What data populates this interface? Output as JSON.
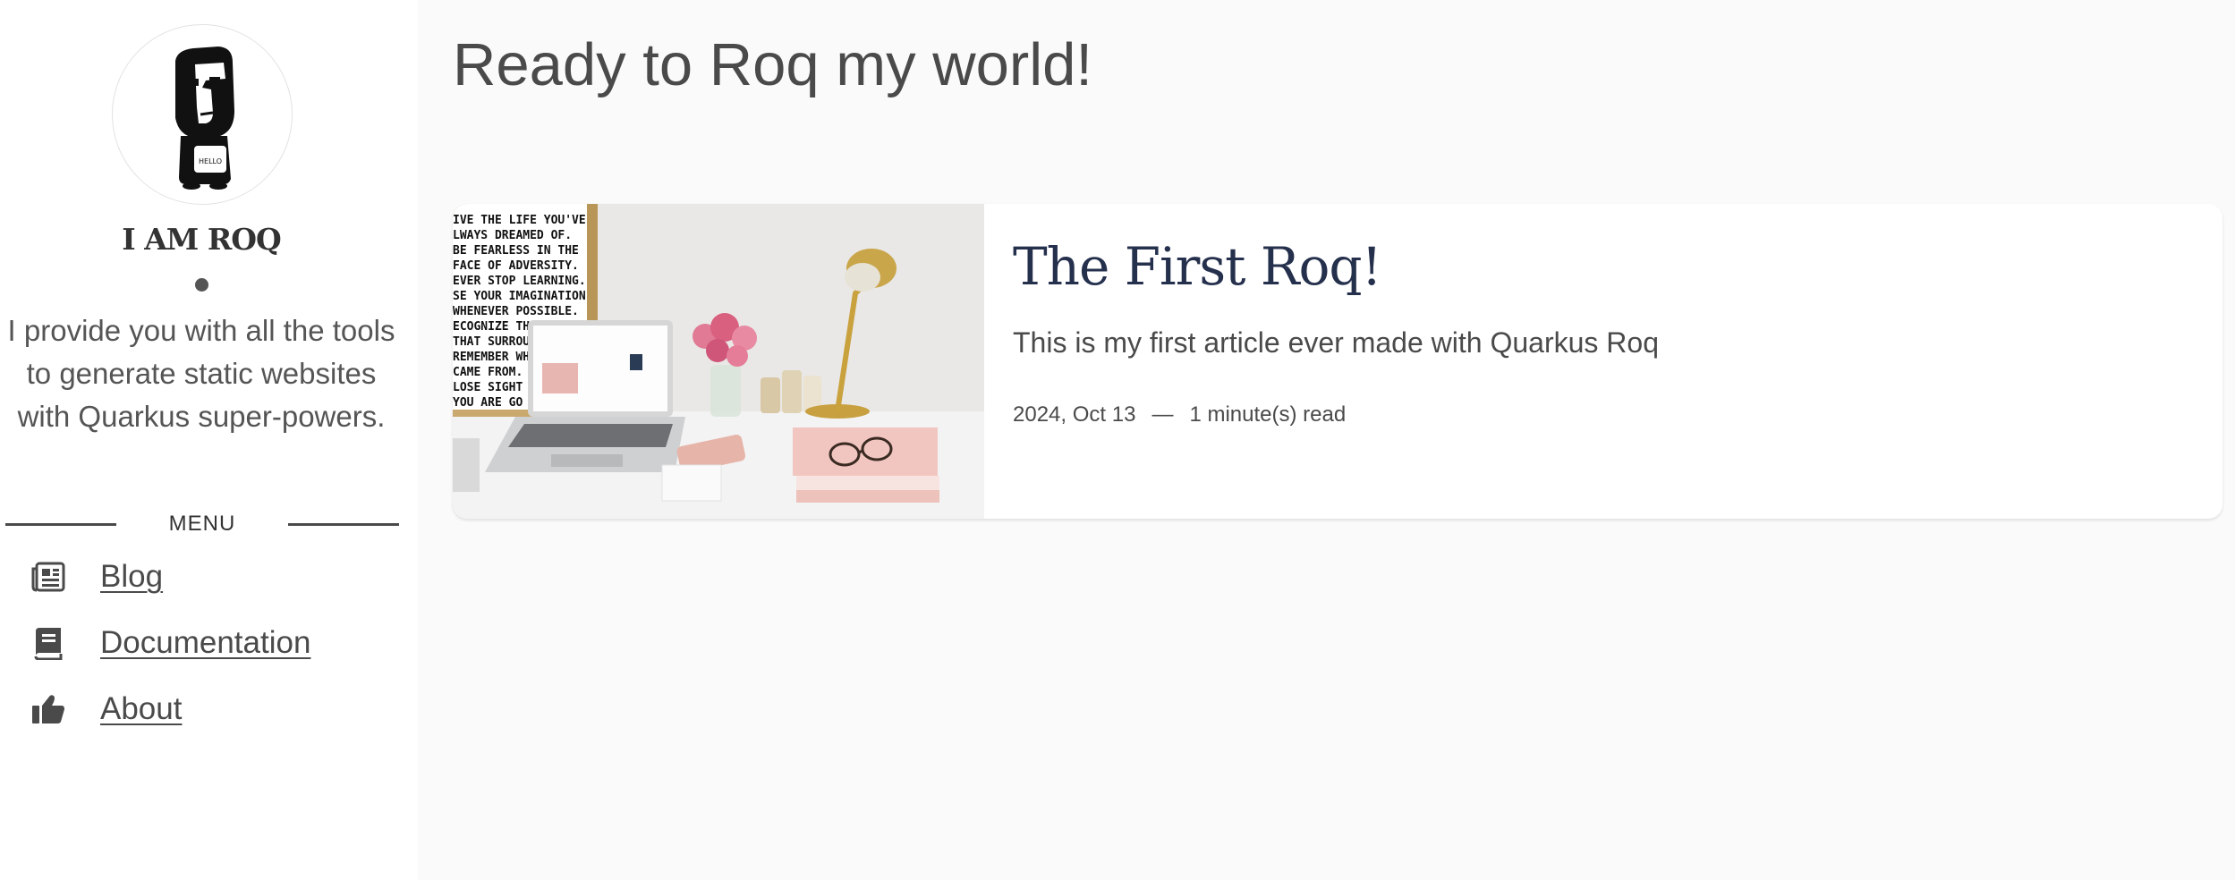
{
  "sidebar": {
    "site_title": "I AM ROQ",
    "tagline": "I provide you with all the tools to generate static websites with Quarkus super-powers.",
    "avatar_badge_text": "HELLO",
    "menu_label": "MENU",
    "items": [
      {
        "label": "Blog",
        "icon": "newspaper-icon"
      },
      {
        "label": "Documentation",
        "icon": "book-icon"
      },
      {
        "label": "About",
        "icon": "thumbs-up-icon"
      }
    ]
  },
  "main": {
    "title": "Ready to Roq my world!",
    "posts": [
      {
        "title": "The First Roq!",
        "description": "This is my first article ever made with Quarkus Roq",
        "date": "2024, Oct 13",
        "separator": "—",
        "read_time": "1 minute(s) read",
        "image": "desk-laptop-flowers-image",
        "poster_lines": [
          "IVE THE LIFE YOU'VE",
          "LWAYS DREAMED OF.",
          "BE FEARLESS IN THE",
          "FACE OF ADVERSITY.",
          "EVER STOP LEARNING.",
          "SE YOUR IMAGINATION",
          "WHENEVER POSSIBLE.",
          "ECOGNIZE THE   AUTY",
          "THAT SURROUNI",
          "REMEMBER WHI",
          "CAME FROM. BU",
          "LOSE SIGHT OF",
          "YOU ARE GO"
        ]
      }
    ]
  },
  "colors": {
    "background": "#fafafa",
    "sidebar": "#ffffff",
    "text": "#4a4a4a",
    "post_title": "#25304d"
  }
}
